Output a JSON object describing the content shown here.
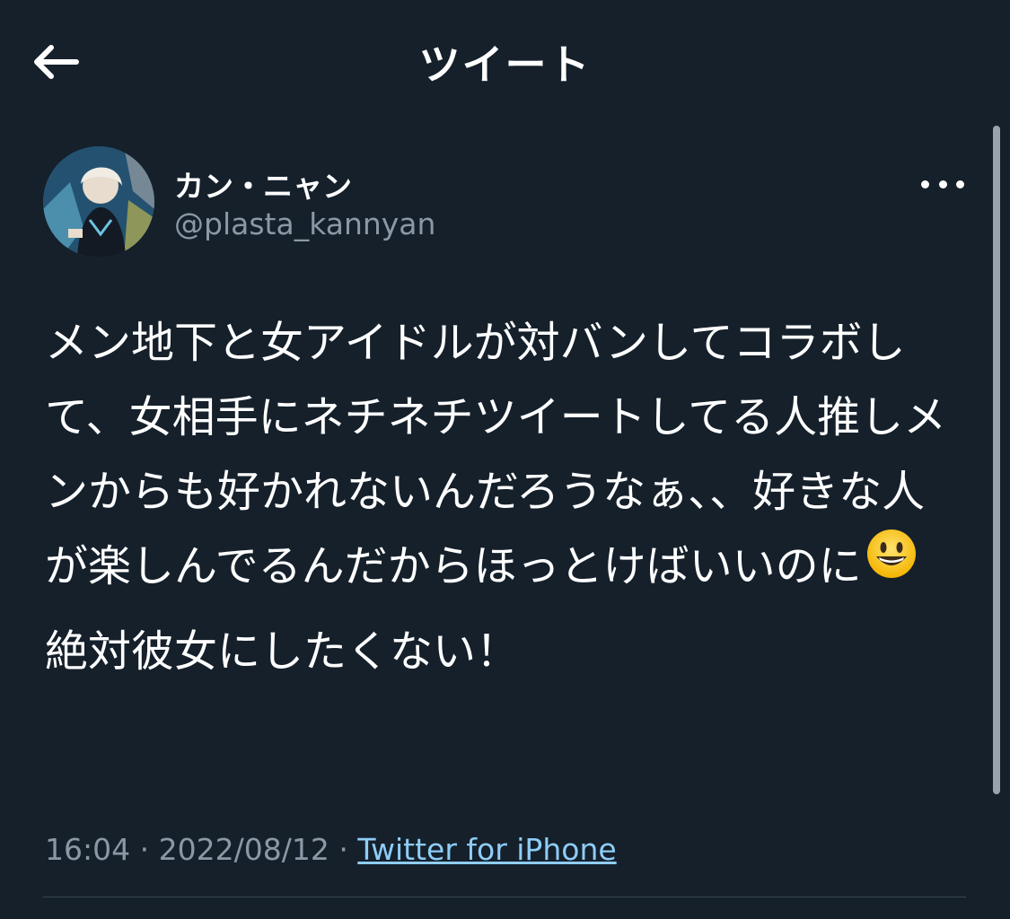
{
  "header": {
    "title": "ツイート",
    "back_icon": "arrow-left-icon"
  },
  "tweet": {
    "author": {
      "display_name": "カン・ニャン",
      "handle": "@plasta_kannyan",
      "avatar": "avatar-photo"
    },
    "more_icon": "more-horizontal-icon",
    "body": {
      "paragraph_1": "メン地下と女アイドルが対バンしてコラボして、女相手にネチネチツイートしてる人推しメンからも好かれないんだろうなぁ、、好きな人が楽しんでるんだからほっとけばいいのに",
      "emoji": "grinning-face-emoji",
      "paragraph_2": "絶対彼女にしたくない！"
    },
    "meta": {
      "time": "16:04",
      "separator": "·",
      "date": "2022/08/12",
      "source": "Twitter for iPhone"
    }
  },
  "colors": {
    "background": "#15202b",
    "text_primary": "#ffffff",
    "text_secondary": "#8b98a5",
    "link": "#8ecdf7",
    "divider": "#38444d"
  }
}
